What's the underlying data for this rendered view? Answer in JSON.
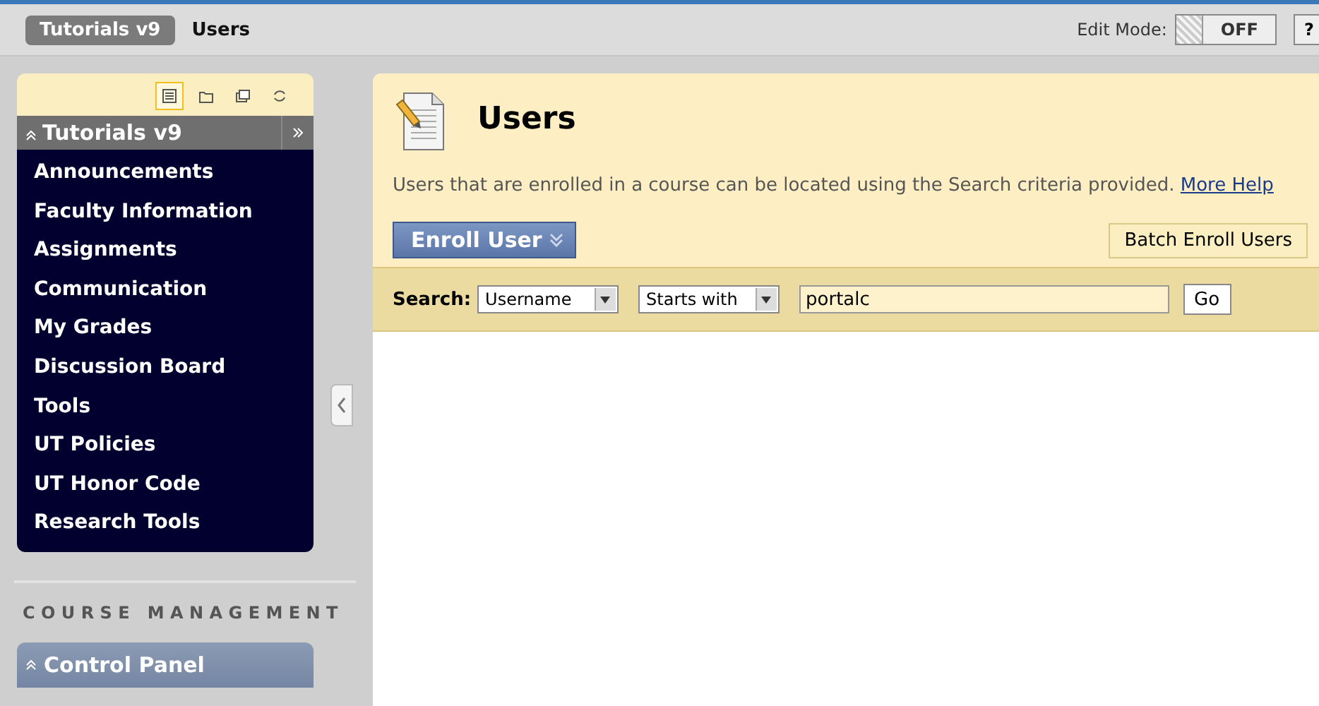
{
  "breadcrumbs": [
    {
      "label": "Tutorials v9",
      "kind": "pill"
    },
    {
      "label": "Users",
      "kind": "plain"
    }
  ],
  "edit_mode": {
    "label": "Edit Mode:",
    "state": "OFF",
    "on": false
  },
  "help_button": "?",
  "menu_views": [
    {
      "selected": true
    },
    {
      "selected": false
    },
    {
      "selected": false
    },
    {
      "selected": false
    }
  ],
  "course_menu": {
    "title": "Tutorials v9",
    "expanded": true,
    "items": [
      "Announcements",
      "Faculty Information",
      "Assignments",
      "Communication",
      "My Grades",
      "Discussion Board",
      "Tools",
      "UT Policies",
      "UT Honor Code",
      "Research Tools"
    ]
  },
  "section_heading": "COURSE MANAGEMENT",
  "control_panel": {
    "title": "Control Panel",
    "expanded": true
  },
  "page": {
    "title": "Users",
    "description": "Users that are enrolled in a course can be located using the Search criteria provided.",
    "help_link": "More Help"
  },
  "actions": [
    {
      "label": "Enroll User",
      "kind": "menu"
    },
    {
      "label": "Batch Enroll Users",
      "kind": "plain"
    }
  ],
  "search": {
    "label": "Search:",
    "field": "Username",
    "operator": "Starts with",
    "value": "portalc",
    "button": "Go"
  }
}
